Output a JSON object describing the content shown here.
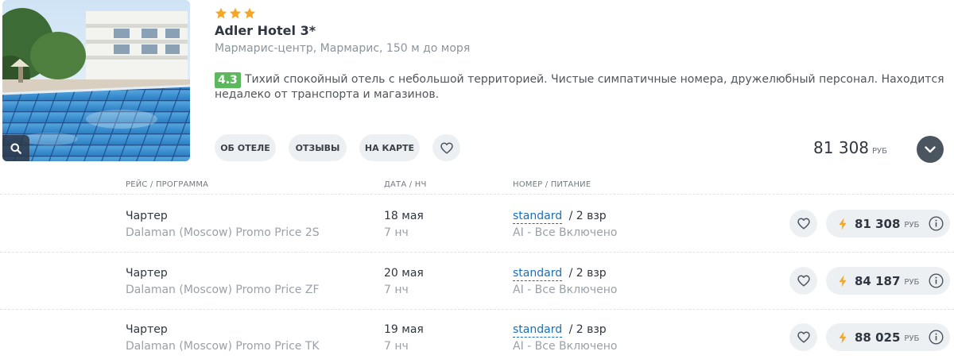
{
  "hotel": {
    "stars": 3,
    "name": "Adler Hotel 3*",
    "location": "Мармарис-центр, Мармарис, 150 м до моря",
    "rating": "4.3",
    "description": "Тихий спокойный отель с небольшой территорией. Чистые симпатичные номера, дружелюбный персонал. Находится недалеко от транспорта и магазинов.",
    "buttons": {
      "about": "ОБ ОТЕЛЕ",
      "reviews": "ОТЗЫВЫ",
      "map": "НА КАРТЕ"
    },
    "min_price": "81 308",
    "currency": "РУБ"
  },
  "table": {
    "headers": {
      "flight": "РЕЙС / ПРОГРАММА",
      "date": "ДАТА / НЧ",
      "room": "НОМЕР / ПИТАНИЕ"
    },
    "rows": [
      {
        "flight_type": "Чартер",
        "program": "Dalaman (Moscow) Promo Price 2S",
        "date": "18 мая",
        "nights": "7 нч",
        "room": "standard",
        "guests": "/ 2 взр",
        "meal": "AI - Все Включено",
        "price": "81 308",
        "currency": "РУБ"
      },
      {
        "flight_type": "Чартер",
        "program": "Dalaman (Moscow) Promo Price ZF",
        "date": "20 мая",
        "nights": "7 нч",
        "room": "standard",
        "guests": "/ 2 взр",
        "meal": "AI - Все Включено",
        "price": "84 187",
        "currency": "РУБ"
      },
      {
        "flight_type": "Чартер",
        "program": "Dalaman (Moscow) Promo Price TK",
        "date": "19 мая",
        "nights": "7 нч",
        "room": "standard",
        "guests": "/ 2 взр",
        "meal": "AI - Все Включено",
        "price": "88 025",
        "currency": "РУБ"
      }
    ]
  },
  "colors": {
    "star": "#f5a623",
    "rating_badge": "#5cb85c",
    "room_link": "#1c6fb5",
    "bolt": "#f5a623",
    "expand_button": "#4b5560"
  },
  "icons": {
    "zoom": "magnifier-icon",
    "favorite": "heart-icon",
    "expand": "chevron-down-icon",
    "hot_price": "lightning-icon",
    "info": "info-icon",
    "star": "star-icon"
  }
}
